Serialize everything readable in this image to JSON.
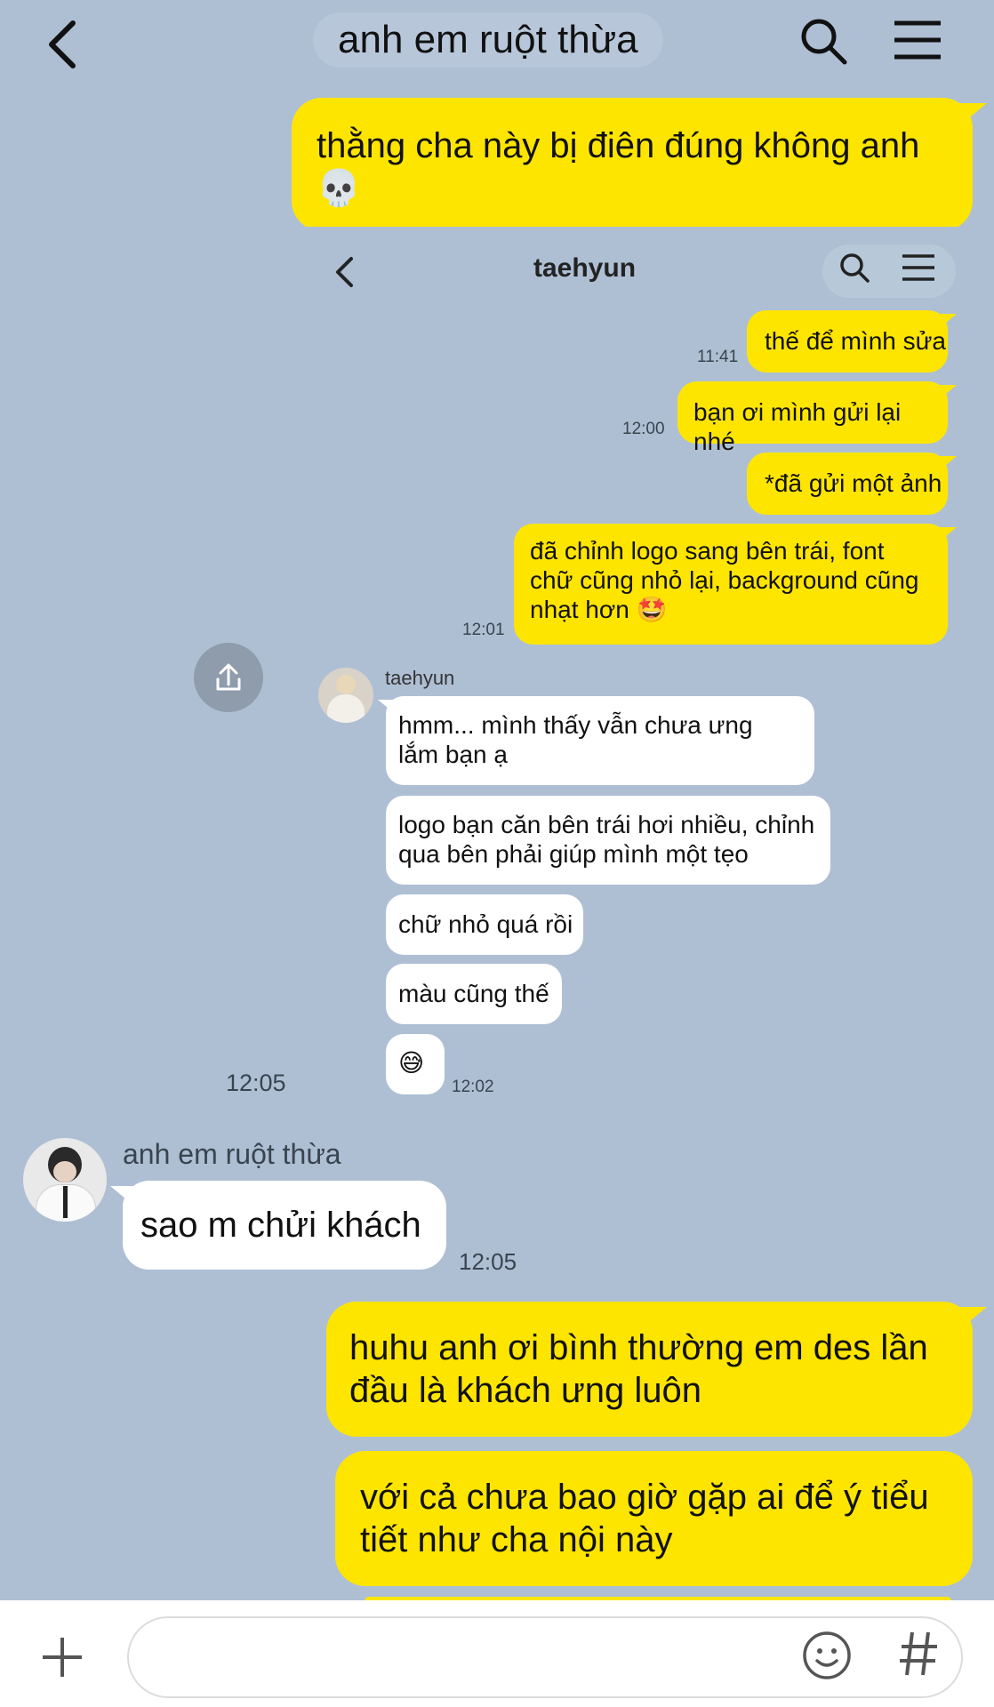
{
  "header": {
    "title": "anh em ruột thừa"
  },
  "messages": {
    "m1": "thằng cha này bị điên đúng không anh 💀",
    "reply_sender": "anh em ruột thừa",
    "reply": "sao m chửi khách",
    "reply_time": "12:05",
    "m2": "huhu anh ơi bình thường em des lần đầu là khách ưng luôn",
    "m3": "với cả chưa bao giờ gặp ai để ý tiểu tiết như cha nội này"
  },
  "screenshot": {
    "title": "taehyun",
    "sent": [
      {
        "text": "thế để mình sửa",
        "time": "11:41"
      },
      {
        "text": "bạn ơi mình gửi lại nhé",
        "time": "12:00"
      },
      {
        "text": "*đã gửi một ảnh",
        "time": ""
      },
      {
        "text": "đã chỉnh logo sang bên trái, font chữ cũng nhỏ lại, background cũng nhạt hơn 🤩",
        "time": "12:01"
      }
    ],
    "sender": "taehyun",
    "received": [
      "hmm... mình thấy vẫn chưa ưng lắm bạn ạ",
      "logo bạn căn bên trái hơi nhiều, chỉnh qua bên phải giúp mình một tẹo",
      "chữ nhỏ quá rồi",
      "màu cũng thế",
      "😅"
    ],
    "received_time": "12:02",
    "outer_time": "12:05"
  }
}
